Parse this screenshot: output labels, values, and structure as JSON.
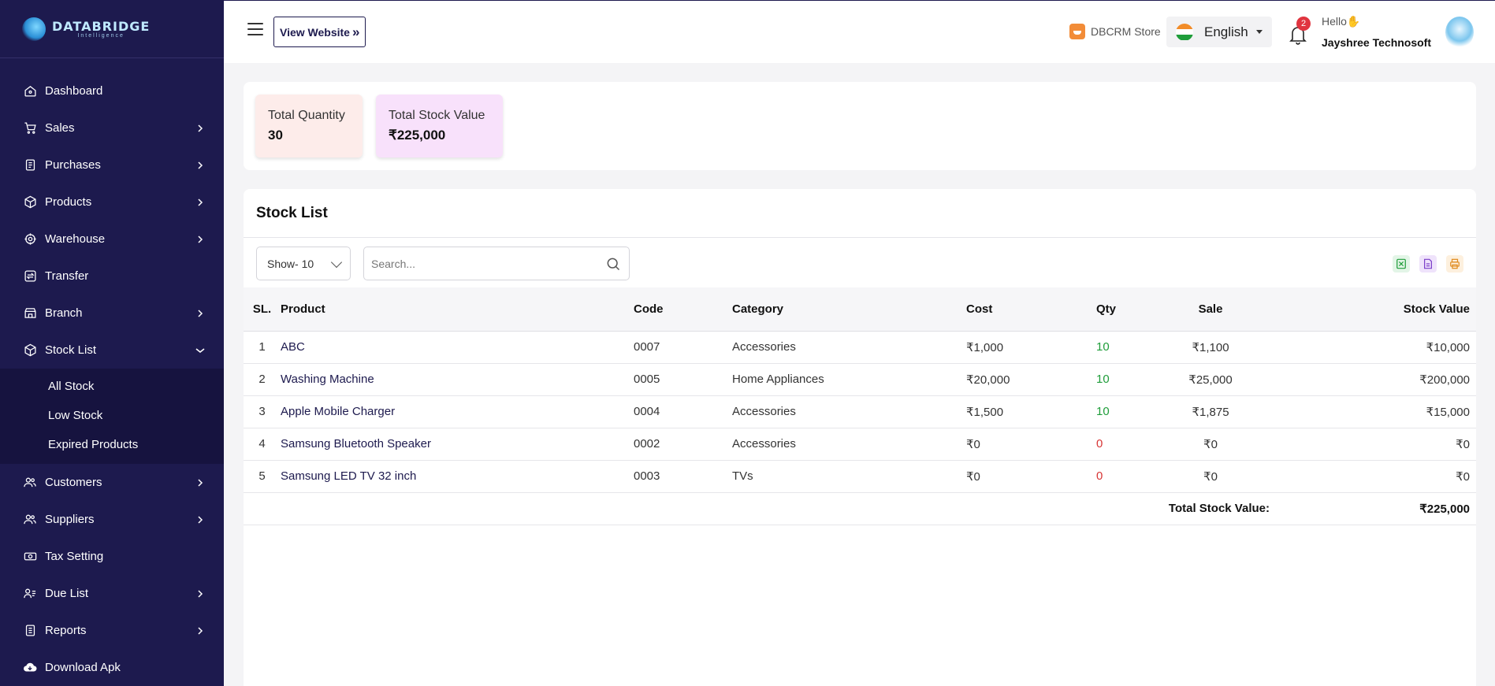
{
  "brand": {
    "title": "DATABRIDGE",
    "subtitle": "Intelligence"
  },
  "sidebar": {
    "items": [
      {
        "label": "Dashboard",
        "icon": "home-icon",
        "has_chevron": false
      },
      {
        "label": "Sales",
        "icon": "cart-icon",
        "has_chevron": true
      },
      {
        "label": "Purchases",
        "icon": "receipt-icon",
        "has_chevron": true
      },
      {
        "label": "Products",
        "icon": "box-icon",
        "has_chevron": true
      },
      {
        "label": "Warehouse",
        "icon": "warehouse-icon",
        "has_chevron": true
      },
      {
        "label": "Transfer",
        "icon": "transfer-icon",
        "has_chevron": false
      },
      {
        "label": "Branch",
        "icon": "branch-icon",
        "has_chevron": true
      },
      {
        "label": "Stock List",
        "icon": "stock-icon",
        "has_chevron": true,
        "expanded": true
      },
      {
        "label": "Customers",
        "icon": "customers-icon",
        "has_chevron": true
      },
      {
        "label": "Suppliers",
        "icon": "suppliers-icon",
        "has_chevron": true
      },
      {
        "label": "Tax Setting",
        "icon": "tax-icon",
        "has_chevron": false
      },
      {
        "label": "Due List",
        "icon": "due-list-icon",
        "has_chevron": true
      },
      {
        "label": "Reports",
        "icon": "reports-icon",
        "has_chevron": true
      },
      {
        "label": "Download Apk",
        "icon": "cloud-download-icon",
        "has_chevron": false
      }
    ],
    "stock_submenu": [
      "All Stock",
      "Low Stock",
      "Expired Products"
    ]
  },
  "header": {
    "view_website": "View Website",
    "view_website_icon": "»",
    "store": "DBCRM Store",
    "language": "English",
    "notification_count": "2",
    "greeting": "Hello",
    "greeting_emoji": "✋",
    "username": "Jayshree Technosoft"
  },
  "summary": {
    "total_quantity_label": "Total Quantity",
    "total_quantity": "30",
    "total_stock_value_label": "Total Stock Value",
    "total_stock_value": "₹225,000"
  },
  "stock_list": {
    "title": "Stock List",
    "show": "Show- 10",
    "search_placeholder": "Search...",
    "columns": [
      "SL.",
      "Product",
      "Code",
      "Category",
      "Cost",
      "Qty",
      "Sale",
      "Stock Value"
    ],
    "rows": [
      {
        "sl": "1",
        "product": "ABC",
        "code": "0007",
        "category": "Accessories",
        "cost": "₹1,000",
        "qty": "10",
        "sale": "₹1,100",
        "value": "₹10,000"
      },
      {
        "sl": "2",
        "product": "Washing Machine",
        "code": "0005",
        "category": "Home Appliances",
        "cost": "₹20,000",
        "qty": "10",
        "sale": "₹25,000",
        "value": "₹200,000"
      },
      {
        "sl": "3",
        "product": "Apple Mobile Charger",
        "code": "0004",
        "category": "Accessories",
        "cost": "₹1,500",
        "qty": "10",
        "sale": "₹1,875",
        "value": "₹15,000"
      },
      {
        "sl": "4",
        "product": "Samsung Bluetooth Speaker",
        "code": "0002",
        "category": "Accessories",
        "cost": "₹0",
        "qty": "0",
        "sale": "₹0",
        "value": "₹0"
      },
      {
        "sl": "5",
        "product": "Samsung LED TV 32 inch",
        "code": "0003",
        "category": "TVs",
        "cost": "₹0",
        "qty": "0",
        "sale": "₹0",
        "value": "₹0"
      }
    ],
    "total_label": "Total Stock Value:",
    "total_value": "₹225,000"
  },
  "colors": {
    "sidebar_bg": "#1d1a4e",
    "qty_positive": "#1f9d3a",
    "qty_zero": "#d83636",
    "card_quantity_bg": "#fdecea",
    "card_value_bg": "#f8e1fb"
  }
}
